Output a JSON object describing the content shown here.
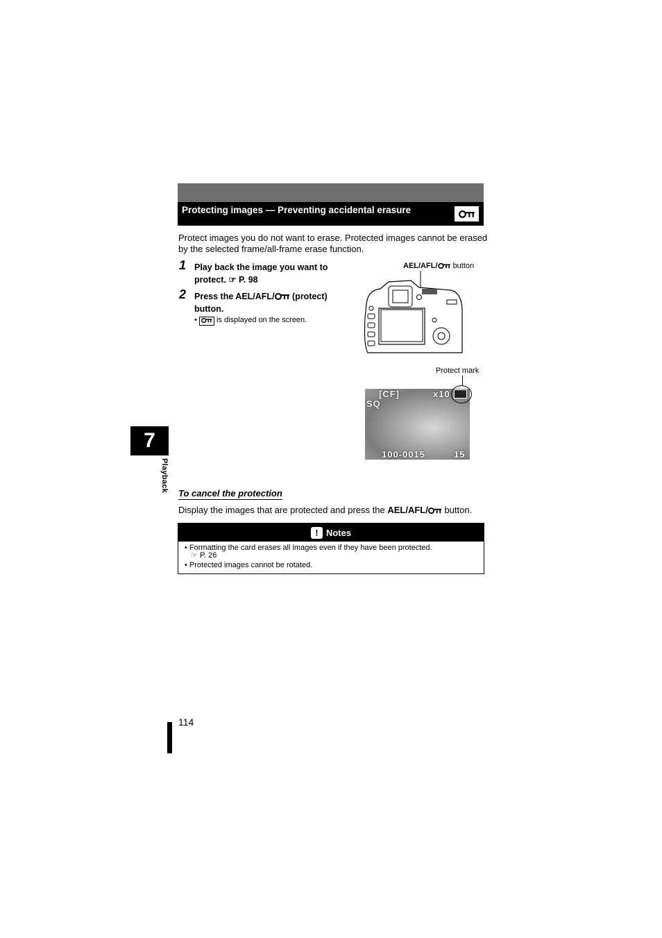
{
  "header": {
    "title": "Protecting images — Preventing accidental erasure",
    "icon": "key-icon"
  },
  "intro": [
    "Protect images you do not want to erase. Protected images cannot be erased",
    "by the selected frame/all-frame erase function."
  ],
  "steps": [
    {
      "number": "1",
      "line1": "Play back the image you want to",
      "line2_prefix": "protect.",
      "ref": "P. 98"
    },
    {
      "number": "2",
      "line1_prefix": "Press the ",
      "button_name": "AEL/AFL/",
      "line1_suffix": " (protect)",
      "line2": "button.",
      "bullet": "is displayed on the screen."
    }
  ],
  "figure1": {
    "label_bold": "AEL/AFL/",
    "label_suffix": "button"
  },
  "figure2": {
    "label": "Protect mark",
    "overlay": {
      "card": "[CF]",
      "zoom": "x10",
      "quality": "SQ",
      "file": "100-0015",
      "count": "15"
    }
  },
  "chapter": {
    "number": "7",
    "label": "Playback"
  },
  "cancel": {
    "heading": "To cancel the protection",
    "text_prefix": "Display the images that are protected and press the ",
    "button_name": "AEL/AFL/",
    "text_suffix": " button."
  },
  "notes": {
    "title": "Notes",
    "icon": "!",
    "items": [
      {
        "text": "Formatting the card erases all images even if they have been protected.",
        "ref": "P. 26"
      },
      {
        "text": "Protected images cannot be rotated."
      }
    ]
  },
  "footer": {
    "page_number": "114"
  }
}
